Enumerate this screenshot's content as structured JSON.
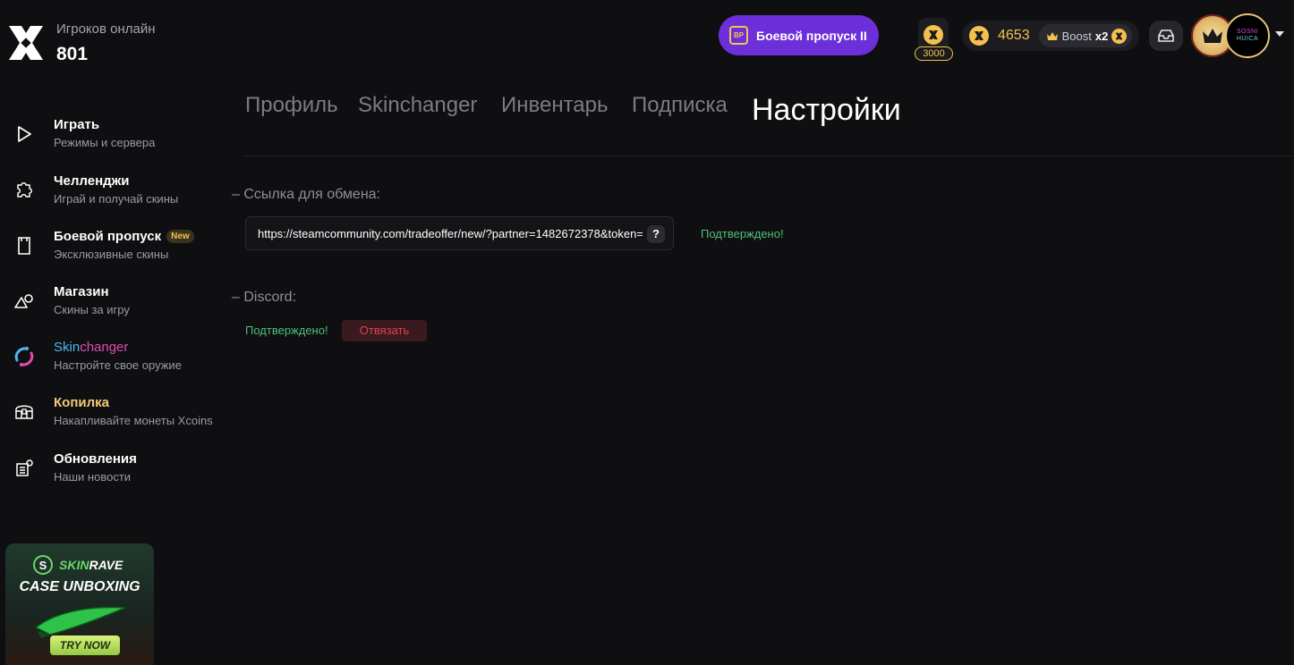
{
  "header": {
    "online_label": "Игроков онлайн",
    "online_count": "801",
    "battlepass_badge": "BP",
    "battlepass_label": "Боевой пропуск II",
    "reward_amount": "3000",
    "balance": "4653",
    "boost_label": "Boost",
    "boost_multiplier": "x2",
    "avatar_text_line1": "SOSNI",
    "avatar_text_line2": "HUICA",
    "colors": {
      "accent_purple": "#6c2fd9",
      "coin_gold": "#f2c14e"
    }
  },
  "sidebar": {
    "items": [
      {
        "title": "Играть",
        "subtitle": "Режимы и сервера",
        "icon": "play-icon"
      },
      {
        "title": "Челленджи",
        "subtitle": "Играй и получай скины",
        "icon": "puzzle-icon"
      },
      {
        "title": "Боевой пропуск",
        "badge": "New",
        "subtitle": "Эксклюзивные скины",
        "icon": "battlepass-icon"
      },
      {
        "title": "Магазин",
        "subtitle": "Скины за игру",
        "icon": "shapes-icon"
      },
      {
        "title_part1": "Skin",
        "title_part2": "changer",
        "subtitle": "Настройте свое оружие",
        "icon": "skinchanger-icon"
      },
      {
        "title": "Копилка",
        "subtitle": "Накапливайте монеты Xcoins",
        "icon": "chest-icon"
      },
      {
        "title": "Обновления",
        "subtitle": "Наши новости",
        "icon": "news-icon"
      }
    ]
  },
  "promo": {
    "brand_part1": "SKIN",
    "brand_part2": "RAVE",
    "headline": "CASE UNBOXING",
    "cta": "TRY NOW"
  },
  "tabs": [
    {
      "label": "Профиль",
      "active": false
    },
    {
      "label": "Skinchanger",
      "active": false
    },
    {
      "label": "Инвентарь",
      "active": false
    },
    {
      "label": "Подписка",
      "active": false
    },
    {
      "label": "Настройки",
      "active": true
    }
  ],
  "settings": {
    "trade_label": "–  Ссылка для обмена:",
    "trade_url": "https://steamcommunity.com/tradeoffer/new/?partner=1482672378&token=",
    "trade_help": "?",
    "trade_status": "Подтверждено!",
    "discord_label": "–  Discord:",
    "discord_status": "Подтверждено!",
    "unlink_label": "Отвязать"
  }
}
